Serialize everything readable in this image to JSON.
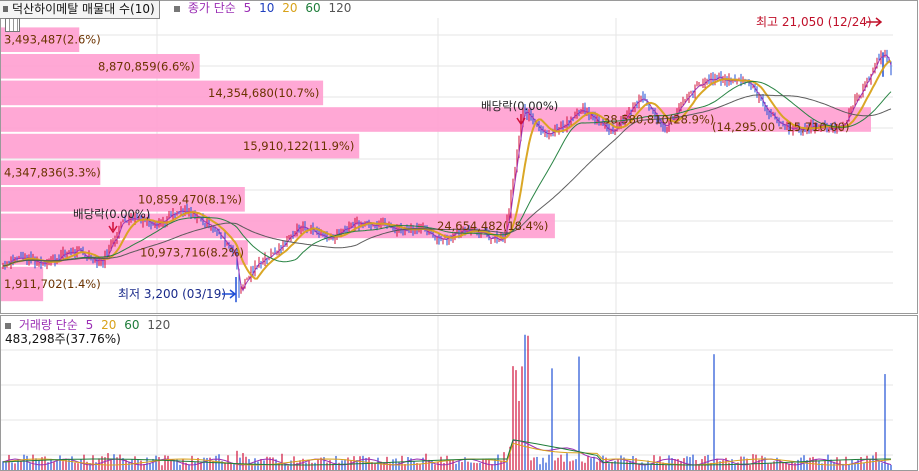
{
  "title_tab": "덕산하이메탈 매물대 수(10)",
  "price_legend": {
    "label": "종가 단순",
    "periods": [
      {
        "text": "5",
        "color": "#9b2fb5"
      },
      {
        "text": "10",
        "color": "#1f3fbf"
      },
      {
        "text": "20",
        "color": "#d8a21a"
      },
      {
        "text": "60",
        "color": "#1e7d3a"
      },
      {
        "text": "120",
        "color": "#555555"
      }
    ]
  },
  "volume_legend": {
    "label": "거래량 단순",
    "periods": [
      {
        "text": "5",
        "color": "#9b2fb5"
      },
      {
        "text": "20",
        "color": "#d8a21a"
      },
      {
        "text": "60",
        "color": "#1e7d3a"
      },
      {
        "text": "120",
        "color": "#555555"
      }
    ]
  },
  "colors": {
    "up": "#d0103a",
    "down": "#1f4fd6",
    "profile": "#ff9ed0",
    "label": "#6b3300"
  },
  "chart_data": {
    "type": "candlestick-with-volume-profile",
    "price_range": [
      2500,
      23500
    ],
    "high": {
      "text": "최고 21,050 (12/24)",
      "value": 21050
    },
    "low": {
      "text": "최저 3,200 (03/19)",
      "value": 3200
    },
    "dividend_markers": [
      {
        "text": "배당락(0.00%)",
        "date_index": 110
      },
      {
        "text": "배당락(0.00%)",
        "date_index": 518
      }
    ],
    "volume_profile": [
      {
        "label": "3,493,487(2.6%)",
        "price_low": 21000,
        "price_high": 22900,
        "share": 2.6
      },
      {
        "label": "8,870,859(6.6%)",
        "price_low": 19100,
        "price_high": 21000,
        "share": 6.6
      },
      {
        "label": "14,354,680(10.7%)",
        "price_low": 17200,
        "price_high": 19100,
        "share": 10.7
      },
      {
        "label": "38,580,810(28.9%)",
        "price_low": 15300,
        "price_high": 17200,
        "share": 28.9
      },
      {
        "label": "15,910,122(11.9%)",
        "price_low": 13400,
        "price_high": 15300,
        "share": 11.9
      },
      {
        "label": "4,347,836(3.3%)",
        "price_low": 11500,
        "price_high": 13400,
        "share": 3.3
      },
      {
        "label": "10,859,470(8.1%)",
        "price_low": 9600,
        "price_high": 11500,
        "share": 8.1
      },
      {
        "label": "24,654,482(18.4%)",
        "price_low": 7700,
        "price_high": 9600,
        "share": 18.4
      },
      {
        "label": "10,973,716(8.2%)",
        "price_low": 5800,
        "price_high": 7700,
        "share": 8.2
      },
      {
        "label": "1,911,702(1.4%)",
        "price_low": 3200,
        "price_high": 5800,
        "share": 1.4
      }
    ],
    "overlay_label": {
      "text": "(14,295.00 - 15,710.00)",
      "value": 15700
    },
    "volume": {
      "last": "483,298주(37.76%)"
    }
  }
}
